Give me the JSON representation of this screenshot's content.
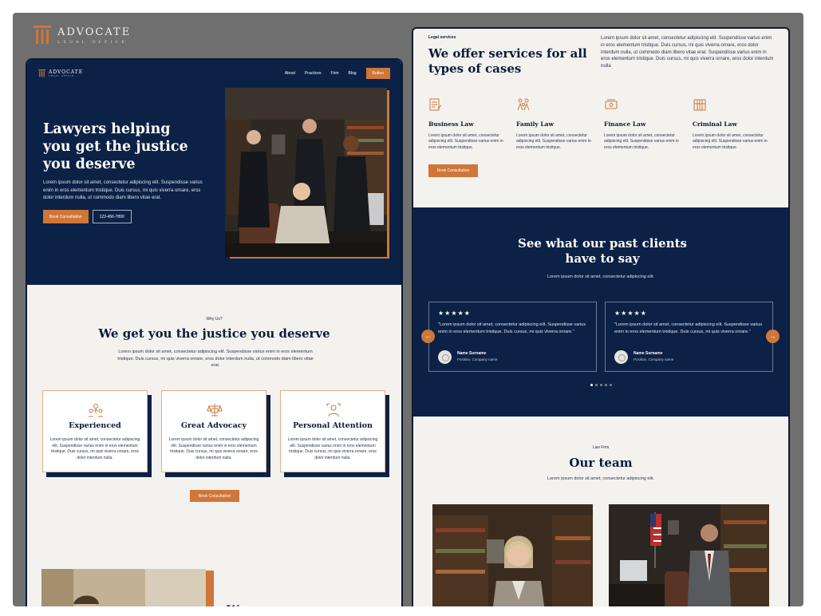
{
  "brand": {
    "name": "ADVOCATE",
    "sub": "LEGAL OFFICE"
  },
  "left": {
    "nav": {
      "logo_name": "ADVOCATE",
      "logo_sub": "LEGAL OFFICE",
      "links": [
        "About",
        "Practices",
        "Firm",
        "Blog"
      ],
      "button": "Button"
    },
    "hero": {
      "title": "Lawyers helping you get the justice you deserve",
      "text": "Lorem ipsum dolor sit amet, consectetur adipiscing elit. Suspendisse varius enim in eros elementum tristique. Duis cursus, mi quis viverra ornare, eros dolor interdum nulla, ut commodo diam libero vitae erat.",
      "cta": "Book Consultation",
      "phone": "123-456-7890"
    },
    "why": {
      "label": "Why Us?",
      "title": "We get you the justice you deserve",
      "text": "Lorem ipsum dolor sit amet, consectetur adipiscing elit. Suspendisse varius enim in eros elementum tristique. Duis cursus, mi quis viverra ornare, eros dolor interdum nulla, ut commodo diam libero vitae erat."
    },
    "cards": [
      {
        "icon": "team-icon",
        "title": "Experienced",
        "text": "Lorem ipsum dolor sit amet, consectetur adipiscing elit. Suspendisse varius enim in eros elementum tristique. Duis cursus, mi quis viverra ornare, eros dolor interdum nulla."
      },
      {
        "icon": "scales-icon",
        "title": "Great Advocacy",
        "text": "Lorem ipsum dolor sit amet, consectetur adipiscing elit. Suspendisse varius enim in eros elementum tristique. Duis cursus, mi quis viverra ornare, eros dolor interdum nulla."
      },
      {
        "icon": "person-icon",
        "title": "Personal Attention",
        "text": "Lorem ipsum dolor sit amet, consectetur adipiscing elit. Suspendisse varius enim in eros elementum tristique. Duis cursus, mi quis viverra ornare, eros dolor interdum nulla."
      }
    ],
    "cta_center": "Book Consultation",
    "bottom_heading": "We"
  },
  "right": {
    "services": {
      "label": "Legal services",
      "title": "We offer services for all types of cases",
      "desc": "Lorem ipsum dolor sit amet, consectetur adipiscing elit. Suspendisse varius enim in eros elementum tristique. Duis cursus, mi quis viverra ornare, eros dolor interdum nulla, ut commodo diam libero vitae erat. Suspendisse varius enim in eros elementum tristique. Duis cursus, mi quis viverra ornare, eros dolor interdum nulla",
      "items": [
        {
          "icon": "document-icon",
          "title": "Business Law",
          "text": "Lorem ipsum dolor sit amet, consectetur adipiscing elit. Suspendisse varius enim in eros elementum tristique."
        },
        {
          "icon": "family-icon",
          "title": "Family Law",
          "text": "Lorem ipsum dolor sit amet, consectetur adipiscing elit. Suspendisse varius enim in eros elementum tristique."
        },
        {
          "icon": "money-icon",
          "title": "Finance Law",
          "text": "Lorem ipsum dolor sit amet, consectetur adipiscing elit. Suspendisse varius enim in eros elementum tristique."
        },
        {
          "icon": "jail-icon",
          "title": "Criminal Law",
          "text": "Lorem ipsum dolor sit amet, consectetur adipiscing elit. Suspendisse varius enim in eros elementum tristique."
        }
      ],
      "cta": "Book Consultation"
    },
    "testimonials": {
      "title": "See what our past clients have to say",
      "sub": "Lorem ipsum dolor sit amet, consectetur adipiscing elit.",
      "items": [
        {
          "stars": "★★★★★",
          "quote": "\"Lorem ipsum dolor sit amet, consectetur adipiscing elit. Suspendisse varius enim in eros elementum tristique. Duis cursus, mi quis viverra ornare.\"",
          "name": "Name Surname",
          "position": "Position, Company name"
        },
        {
          "stars": "★★★★★",
          "quote": "\"Lorem ipsum dolor sit amet, consectetur adipiscing elit. Suspendisse varius enim in eros elementum tristique. Duis cursus, mi quis viverra ornare.\"",
          "name": "Name Surname",
          "position": "Position, Company name"
        }
      ],
      "prev_icon": "arrow-left-icon",
      "next_icon": "arrow-right-icon"
    },
    "team": {
      "label": "Law Firm",
      "title": "Our team",
      "sub": "Lorem ipsum dolor sit amet, consectetur adipiscing elit."
    }
  },
  "colors": {
    "navy": "#0c2146",
    "accent": "#cf7638",
    "paper": "#f4f2ef"
  }
}
